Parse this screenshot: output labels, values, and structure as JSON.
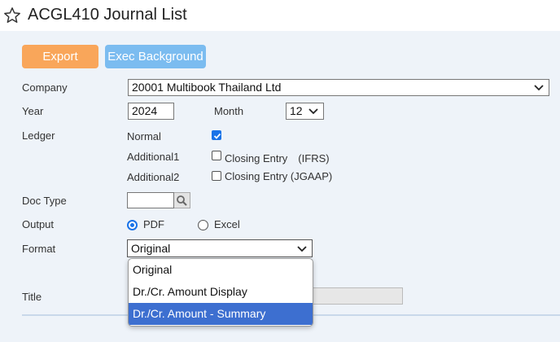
{
  "header": {
    "title": "ACGL410 Journal List",
    "icon": "star-icon"
  },
  "toolbar": {
    "export_label": "Export",
    "exec_label": "Exec Background",
    "export_color": "#f9a65a",
    "exec_color": "#7bbcf0"
  },
  "form": {
    "company": {
      "label": "Company",
      "value": "20001 Multibook Thailand Ltd"
    },
    "year": {
      "label": "Year",
      "value": "2024"
    },
    "month": {
      "label": "Month",
      "value": "12"
    },
    "ledger": {
      "label": "Ledger",
      "rows": [
        {
          "name": "Normal",
          "checked": true,
          "option": ""
        },
        {
          "name": "Additional1",
          "checked": false,
          "option": "Closing Entry　(IFRS)"
        },
        {
          "name": "Additional2",
          "checked": false,
          "option": "Closing Entry (JGAAP)"
        }
      ]
    },
    "doc_type": {
      "label": "Doc Type",
      "value": ""
    },
    "output": {
      "label": "Output",
      "options": [
        "PDF",
        "Excel"
      ],
      "selected": "PDF"
    },
    "format": {
      "label": "Format",
      "value": "Original",
      "options": [
        "Original",
        "Dr./Cr. Amount Display",
        "Dr./Cr. Amount - Summary"
      ],
      "highlighted": "Dr./Cr. Amount - Summary"
    },
    "title": {
      "label": "Title",
      "value": ""
    }
  },
  "colors": {
    "accent": "#1a73e8",
    "highlight": "#3d6fd0",
    "background": "#eef3f9"
  }
}
